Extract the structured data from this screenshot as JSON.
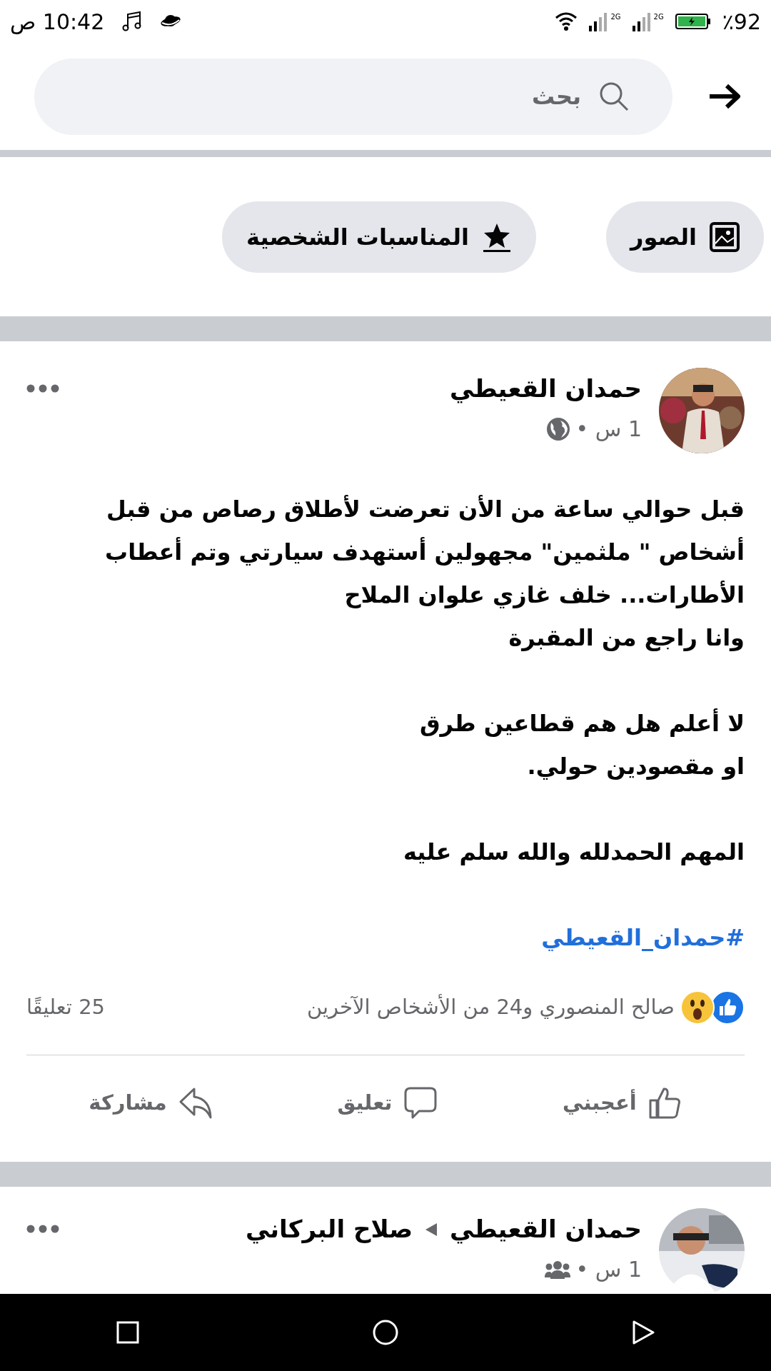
{
  "status_bar": {
    "time": "10:42 ص",
    "battery": "٪92",
    "network_labels": [
      "2G",
      "2G"
    ]
  },
  "search": {
    "placeholder": "بحث"
  },
  "filters": [
    {
      "label": "الصور",
      "kind": "photos"
    },
    {
      "label": "المناسبات الشخصية",
      "kind": "events"
    }
  ],
  "posts": [
    {
      "author": "حمدان القعيطي",
      "time": "1 س •",
      "audience": {
        "kind": "public"
      },
      "paragraphs": [
        [
          "قبل حوالي ساعة من الأن تعرضت لأطلاق رصاص من قبل",
          "أشخاص \" ملثمين\" مجهولين أستهدف سيارتي وتم أعطاب",
          "الأطارات... خلف غازي علوان الملاح",
          "وانا راجع من المقبرة"
        ],
        [
          "لا أعلم هل هم قطاعين طرق",
          "او مقصودين حولي."
        ],
        [
          "المهم الحمدلله والله سلم عليه"
        ]
      ],
      "hashtag": "#حمدان_القعيطي",
      "reactions": {
        "types": [
          {
            "kind": "like"
          },
          {
            "kind": "wow"
          }
        ],
        "summary": "صالح المنصوري و24 من الأشخاص الآخرين",
        "comments": "25 تعليقًا"
      },
      "actions": [
        {
          "label": "أعجبني",
          "kind": "like"
        },
        {
          "label": "تعليق",
          "kind": "comment"
        },
        {
          "label": "مشاركة",
          "kind": "share"
        }
      ]
    },
    {
      "author": "حمدان القعيطي",
      "target": "صلاح البركاني",
      "time": "1 س •",
      "audience": {
        "kind": "friends"
      }
    }
  ]
}
